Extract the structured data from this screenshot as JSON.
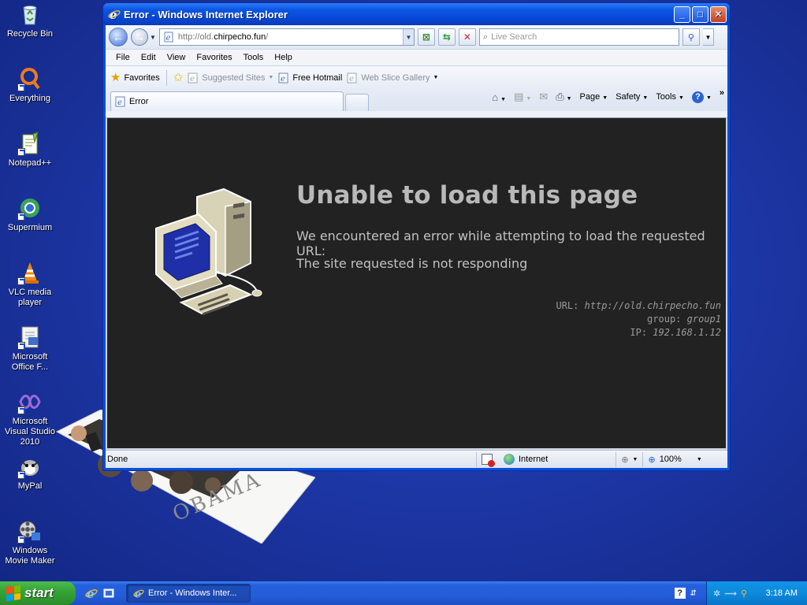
{
  "desktop": {
    "icons": [
      {
        "label": "Recycle Bin",
        "icon": "recycle-bin-icon"
      },
      {
        "label": "Everything",
        "icon": "everything-search-icon"
      },
      {
        "label": "Notepad++",
        "icon": "notepad-plus-plus-icon"
      },
      {
        "label": "Supermium",
        "icon": "supermium-browser-icon"
      },
      {
        "label": "VLC media player",
        "icon": "vlc-cone-icon"
      },
      {
        "label": "Microsoft Office F...",
        "icon": "office-document-icon"
      },
      {
        "label": "Microsoft Visual Studio 2010",
        "icon": "visual-studio-icon"
      },
      {
        "label": "MyPal",
        "icon": "mypal-browser-icon"
      },
      {
        "label": "Windows Movie Maker",
        "icon": "movie-maker-icon"
      }
    ],
    "wallpaper_photo_caption": "OBAMA"
  },
  "window": {
    "title": "Error - Windows Internet Explorer",
    "address": {
      "prefix": "http://old.",
      "host": "chirpecho.fun",
      "suffix": "/"
    },
    "search_placeholder": "Live Search",
    "menu": [
      "File",
      "Edit",
      "View",
      "Favorites",
      "Tools",
      "Help"
    ],
    "favorites": {
      "favorites_label": "Favorites",
      "items": [
        {
          "label": "Suggested Sites",
          "dim": true
        },
        {
          "label": "Free Hotmail",
          "dim": false
        },
        {
          "label": "Web Slice Gallery",
          "dim": true
        }
      ]
    },
    "tab_title": "Error",
    "commands": [
      "Page",
      "Safety",
      "Tools"
    ],
    "page": {
      "heading": "Unable to load this page",
      "line1": "We encountered an error while attempting to load the requested URL:",
      "line2": "The site requested is not responding",
      "meta": [
        {
          "key": "URL:",
          "value": "http://old.chirpecho.fun"
        },
        {
          "key": "group:",
          "value": "group1"
        },
        {
          "key": "IP:",
          "value": "192.168.1.12"
        }
      ]
    },
    "status": {
      "text": "Done",
      "zone": "Internet",
      "zoom": "100%"
    }
  },
  "taskbar": {
    "start_label": "start",
    "task_label": "Error - Windows Inter...",
    "clock": "3:18 AM"
  }
}
